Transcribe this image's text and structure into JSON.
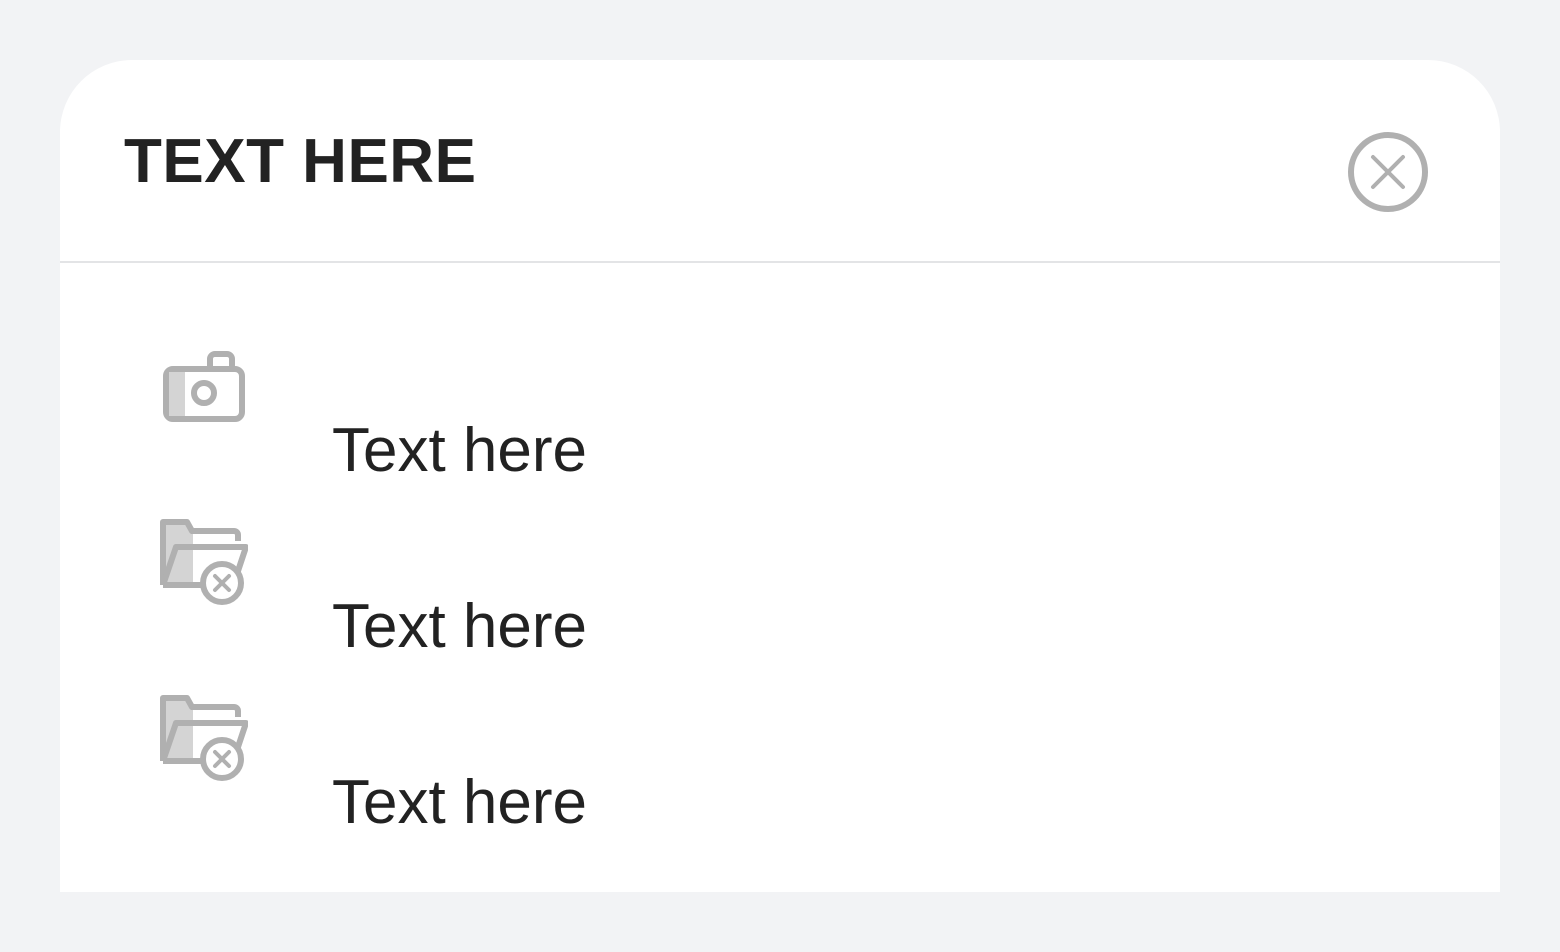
{
  "sheet": {
    "title": "TEXT HERE",
    "close_icon": "close-circle-icon"
  },
  "items": [
    {
      "label": "Text here",
      "icon": "camera-icon"
    },
    {
      "label": "Text here",
      "icon": "folder-remove-icon"
    },
    {
      "label": "Text here",
      "icon": "folder-remove-icon"
    }
  ],
  "colors": {
    "background": "#f2f3f5",
    "surface": "#ffffff",
    "text": "#222222",
    "icon": "#b0b0b0",
    "divider": "#e3e4e6"
  }
}
